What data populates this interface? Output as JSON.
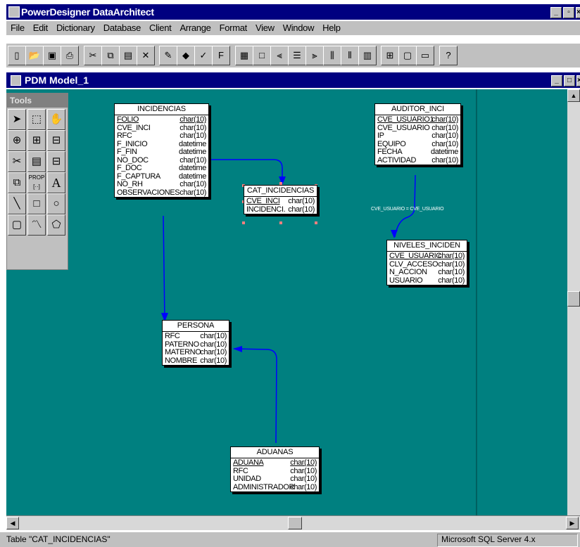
{
  "app": {
    "title": "PowerDesigner DataArchitect"
  },
  "menu": [
    "File",
    "Edit",
    "Dictionary",
    "Database",
    "Client",
    "Arrange",
    "Format",
    "View",
    "Window",
    "Help"
  ],
  "toolbar_icons": [
    "new-icon",
    "open-icon",
    "save-icon",
    "print-icon",
    "cut-icon",
    "copy-icon",
    "paste-icon",
    "delete-icon",
    "pencil-icon",
    "fill-icon",
    "check-icon",
    "font-icon",
    "table-icon",
    "frame-icon",
    "align-left-icon",
    "align-center-icon",
    "align-right-icon",
    "distribute-icon",
    "spread-icon",
    "columns-icon",
    "zoom-in-icon",
    "page-icon",
    "window-icon",
    "help-icon"
  ],
  "document": {
    "title": "PDM Model_1"
  },
  "tools": {
    "title": "Tools"
  },
  "entities": {
    "incidencias": {
      "name": "INCIDENCIAS",
      "columns": [
        {
          "name": "FOLIO",
          "type": "char(10)"
        },
        {
          "name": "CVE_INCI",
          "type": "char(10)"
        },
        {
          "name": "RFC",
          "type": "char(10)"
        },
        {
          "name": "F_INICIO",
          "type": "datetime"
        },
        {
          "name": "F_FIN",
          "type": "datetime"
        },
        {
          "name": "NO_DOC",
          "type": "char(10)"
        },
        {
          "name": "F_DOC",
          "type": "datetime"
        },
        {
          "name": "F_CAPTURA",
          "type": "datetime"
        },
        {
          "name": "NO_RH",
          "type": "char(10)"
        },
        {
          "name": "OBSERVACIONES",
          "type": "char(10)"
        }
      ]
    },
    "cat_incidencias": {
      "name": "CAT_INCIDENCIAS",
      "columns": [
        {
          "name": "CVE_INCI",
          "type": "char(10)"
        },
        {
          "name": "INCIDENCI.",
          "type": "char(10)"
        }
      ]
    },
    "auditor_inci": {
      "name": "AUDITOR_INCI",
      "columns": [
        {
          "name": "CVE_USUARIO1",
          "type": "char(10)"
        },
        {
          "name": "CVE_USUARIO",
          "type": "char(10)"
        },
        {
          "name": "IP",
          "type": "char(10)"
        },
        {
          "name": "EQUIPO",
          "type": "char(10)"
        },
        {
          "name": "FECHA",
          "type": "datetime"
        },
        {
          "name": "ACTIVIDAD",
          "type": "char(10)"
        }
      ]
    },
    "niveles_inciden": {
      "name": "NIVELES_INCIDEN",
      "columns": [
        {
          "name": "CVE_USUARIC",
          "type": "char(10)"
        },
        {
          "name": "CLV_ACCESO",
          "type": "char(10)"
        },
        {
          "name": "N_ACCION",
          "type": "char(10)"
        },
        {
          "name": "USUARIO",
          "type": "char(10)"
        }
      ]
    },
    "persona": {
      "name": "PERSONA",
      "columns": [
        {
          "name": "RFC",
          "type": "char(10)"
        },
        {
          "name": "PATERNO",
          "type": "char(10)"
        },
        {
          "name": "MATERNO",
          "type": "char(10)"
        },
        {
          "name": "NOMBRE",
          "type": "char(10)"
        }
      ]
    },
    "aduanas": {
      "name": "ADUANAS",
      "columns": [
        {
          "name": "ADUANA",
          "type": "char(10)"
        },
        {
          "name": "RFC",
          "type": "char(10)"
        },
        {
          "name": "UNIDAD",
          "type": "char(10)"
        },
        {
          "name": "ADMINISTRADOR",
          "type": "char(10)"
        }
      ]
    }
  },
  "link_label": "CVE_USUARIO = CVE_USUARIO",
  "status": {
    "left": "Table \"CAT_INCIDENCIAS\"",
    "right": "Microsoft SQL Server 4.x"
  },
  "colors": {
    "canvas": "#008080",
    "titlebar": "#000080",
    "link": "#0000ff",
    "chrome": "#c0c0c0"
  }
}
